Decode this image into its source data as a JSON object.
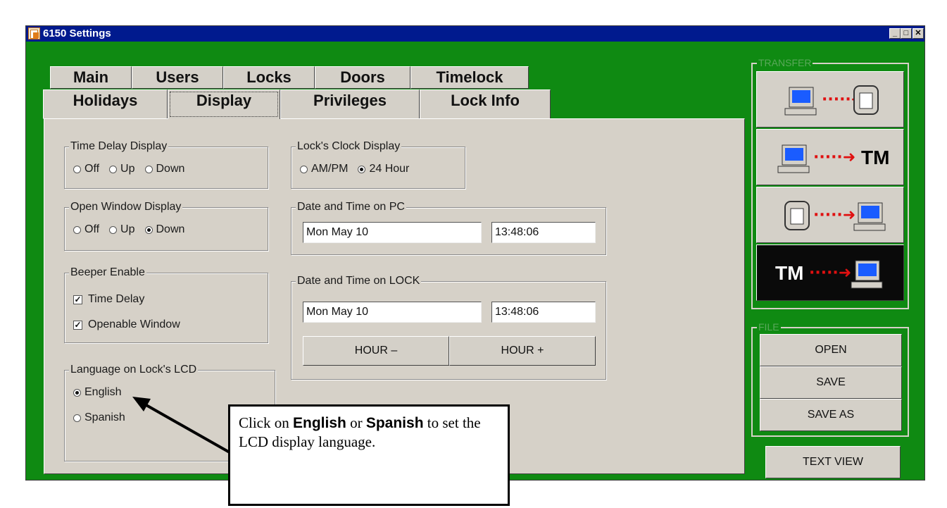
{
  "window": {
    "title": "6150 Settings",
    "min": "_",
    "max": "□",
    "close": "✕"
  },
  "tabs": {
    "row1": [
      {
        "label": "Main"
      },
      {
        "label": "Users"
      },
      {
        "label": "Locks"
      },
      {
        "label": "Doors"
      },
      {
        "label": "Timelock"
      }
    ],
    "row2": [
      {
        "label": "Holidays"
      },
      {
        "label": "Display"
      },
      {
        "label": "Privileges"
      },
      {
        "label": "Lock Info"
      }
    ],
    "active": "Display"
  },
  "display": {
    "time_delay": {
      "legend": "Time Delay Display",
      "options": [
        "Off",
        "Up",
        "Down"
      ],
      "selected": null
    },
    "open_window": {
      "legend": "Open Window Display",
      "options": [
        "Off",
        "Up",
        "Down"
      ],
      "selected": "Down"
    },
    "beeper": {
      "legend": "Beeper Enable",
      "items": [
        {
          "label": "Time Delay",
          "checked": true
        },
        {
          "label": "Openable Window",
          "checked": true
        }
      ]
    },
    "language": {
      "legend": "Language on Lock's LCD",
      "options": [
        "English",
        "Spanish"
      ],
      "selected": "English"
    },
    "clock": {
      "legend": "Lock's Clock Display",
      "options": [
        "AM/PM",
        "24 Hour"
      ],
      "selected": "24 Hour"
    },
    "pc_time": {
      "legend": "Date and Time on PC",
      "date": "Mon May 10",
      "time": "13:48:06"
    },
    "lock_time": {
      "legend": "Date and Time on LOCK",
      "date": "Mon May 10",
      "time": "13:48:06",
      "hour_minus": "HOUR –",
      "hour_plus": "HOUR +"
    }
  },
  "transfer": {
    "legend": "TRANSFER",
    "tm": "TM"
  },
  "file": {
    "legend": "FILE",
    "open": "OPEN",
    "save": "SAVE",
    "save_as": "SAVE AS"
  },
  "text_view": "TEXT VIEW",
  "callout": {
    "pre": "Click on ",
    "english": "English",
    "mid": " or ",
    "spanish": "Spanish",
    "post": " to set the LCD display language."
  },
  "colors": {
    "window_bg": "#0f8a12",
    "titlebar": "#001a8e",
    "panel": "#d6d1c8",
    "arrow": "#e01010"
  }
}
